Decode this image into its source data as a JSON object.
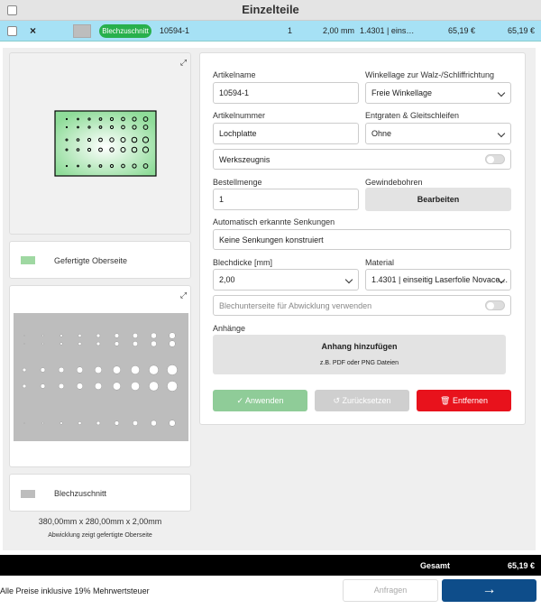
{
  "header": {
    "title": "Einzelteile"
  },
  "row": {
    "close": "×",
    "badge": "Blechzuschnitt",
    "name": "10594-1",
    "qty": "1",
    "thickness": "2,00 mm",
    "material": "1.4301 | eins…",
    "unit_price": "65,19 €",
    "total_price": "65,19 €"
  },
  "left": {
    "legend_top": "Gefertigte Oberseite",
    "legend_bottom": "Blechzuschnitt",
    "dimensions": "380,00mm x 280,00mm x 2,00mm",
    "note": "Abwicklung zeigt gefertigte Oberseite"
  },
  "form": {
    "artikelname_label": "Artikelname",
    "artikelname_value": "10594-1",
    "winkellage_label": "Winkellage zur Walz-/Schliffrichtung",
    "winkellage_value": "Freie Winkellage",
    "artikelnummer_label": "Artikelnummer",
    "artikelnummer_value": "Lochplatte",
    "entgraten_label": "Entgraten & Gleitschleifen",
    "entgraten_value": "Ohne",
    "werkszeugnis_label": "Werkszeugnis",
    "bestellmenge_label": "Bestellmenge",
    "bestellmenge_value": "1",
    "gewinde_label": "Gewindebohren",
    "gewinde_button": "Bearbeiten",
    "senkungen_label": "Automatisch erkannte Senkungen",
    "senkungen_value": "Keine Senkungen konstruiert",
    "blechdicke_label": "Blechdicke [mm]",
    "blechdicke_value": "2,00",
    "material_label": "Material",
    "material_value": "1.4301 | einseitig Laserfolie Novace…",
    "unterseite_label": "Blechunterseite für Abwicklung verwenden",
    "anhaenge_label": "Anhänge",
    "anhang_button": "Anhang hinzufügen",
    "anhang_hint": "z.B. PDF oder PNG Dateien",
    "apply_button": "Anwenden",
    "reset_button": "Zurücksetzen",
    "delete_button": "Entfernen"
  },
  "footer": {
    "total_label": "Gesamt",
    "total_value": "65,19 €",
    "vat_note": "Alle Preise inklusive 19% Mehrwertsteuer",
    "request_button": "Anfragen",
    "next_arrow": "→"
  },
  "colors": {
    "row_bg": "#a6e1f5",
    "badge": "#28b04c",
    "apply": "#8fcc98",
    "delete": "#e8121c",
    "next": "#0e4d8a",
    "preview_green": "#9fe0a8"
  }
}
